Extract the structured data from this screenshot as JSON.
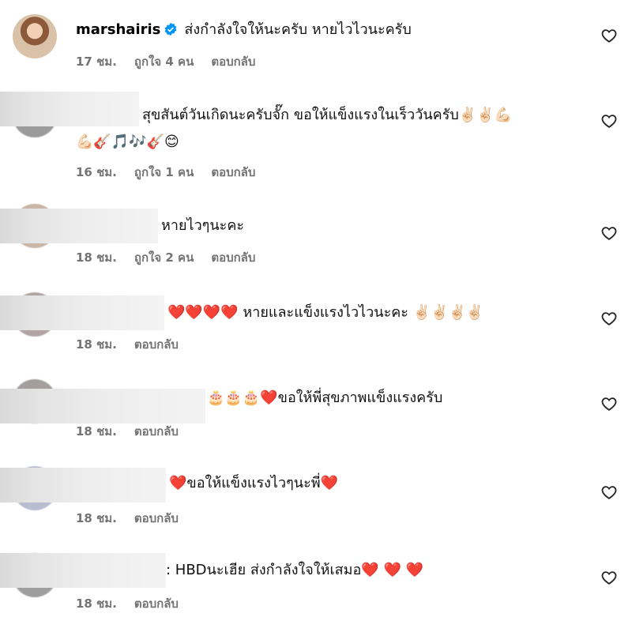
{
  "comments": [
    {
      "username": "marshairis",
      "verified": true,
      "text": "ส่งกำลังใจให้นะครับ หายไวไวนะครับ",
      "time": "17 ชม.",
      "likes": "ถูกใจ 4 คน",
      "reply": "ตอบกลับ"
    },
    {
      "text_line1": "สุขสันต์วันเกิดนะครับจั๊ก ขอให้แข็งแรงในเร็ววันครับ✌🏻✌🏻💪🏻",
      "text_line2": "💪🏻🎸🎵🎶🎸😊",
      "time": "16 ชม.",
      "likes": "ถูกใจ 1 คน",
      "reply": "ตอบกลับ"
    },
    {
      "text": "หายไวๆนะคะ",
      "time": "18 ชม.",
      "likes": "ถูกใจ 2 คน",
      "reply": "ตอบกลับ"
    },
    {
      "text": "❤️❤️❤️❤️ หายและแข็งแรงไวไวนะคะ ✌🏻✌🏻✌🏻✌🏻",
      "time": "18 ชม.",
      "reply": "ตอบกลับ"
    },
    {
      "text": "🎂🎂🎂❤️ขอให้พี่สุขภาพแข็งแรงครับ",
      "time": "18 ชม.",
      "reply": "ตอบกลับ"
    },
    {
      "text": "❤️ขอให้แข็งแรงไวๆนะพี่❤️",
      "time": "18 ชม.",
      "reply": "ตอบกลับ"
    },
    {
      "text": ": HBDนะเฮีย ส่งกำลังใจให้เสมอ❤️ ❤️ ❤️",
      "time": "18 ชม.",
      "reply": "ตอบกลับ"
    }
  ],
  "icons": {
    "verified": "verified-badge-icon",
    "like": "heart-outline-icon"
  },
  "colors": {
    "verified": "#0095f6",
    "meta": "#737373",
    "heart": "#e0182d"
  }
}
